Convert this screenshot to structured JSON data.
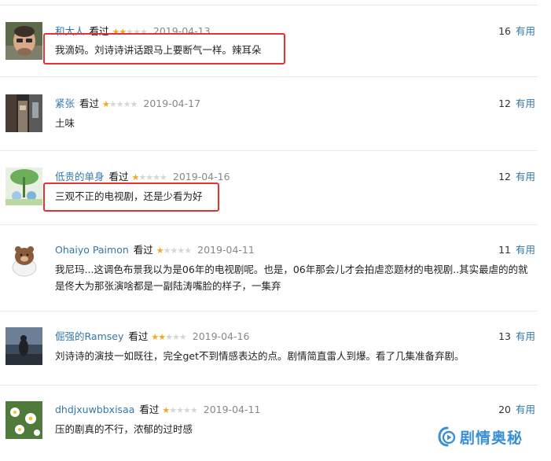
{
  "comments": [
    {
      "user": "和大人",
      "action": "看过",
      "rating": 2,
      "date": "2019-04-13",
      "votes": "16",
      "useful_label": "有用",
      "text": "我滴妈。刘诗诗讲话跟马上要断气一样。辣耳朵",
      "highlighted": true
    },
    {
      "user": "紧张",
      "action": "看过",
      "rating": 1,
      "date": "2019-04-17",
      "votes": "12",
      "useful_label": "有用",
      "text": "土味",
      "highlighted": false
    },
    {
      "user": "低贵的单身",
      "action": "看过",
      "rating": 1,
      "date": "2019-04-16",
      "votes": "12",
      "useful_label": "有用",
      "text": "三观不正的电视剧，还是少看为好",
      "highlighted": true
    },
    {
      "user": "Ohaiyo Paimon",
      "action": "看过",
      "rating": 1,
      "date": "2019-04-11",
      "votes": "11",
      "useful_label": "有用",
      "text": "我尼玛...这调色布景我以为是06年的电视剧呢。也是，06年那会儿才会拍虐恋题材的电视剧..其实最虐的的就是佟大为那张演啥都是一副陆涛嘴脸的样子，一集弃",
      "highlighted": false
    },
    {
      "user": "倔强的Ramsey",
      "action": "看过",
      "rating": 2,
      "date": "2019-04-16",
      "votes": "13",
      "useful_label": "有用",
      "text": "刘诗诗的演技一如既往，完全get不到情感表达的点。剧情简直雷人到爆。看了几集准备弃剧。",
      "highlighted": false
    },
    {
      "user": "dhdjxuwbbxisaa",
      "action": "看过",
      "rating": 1,
      "date": "2019-04-11",
      "votes": "20",
      "useful_label": "有用",
      "text": "压的剧真的不行，浓郁的过时感",
      "highlighted": false
    }
  ],
  "watermark": {
    "text": "剧情奥秘",
    "logo": "play-logo-icon",
    "color": "#3a8fd6"
  },
  "colors": {
    "username": "#3377aa",
    "star_on": "#f5a623",
    "star_off": "#d6d6d6",
    "highlight": "#e53232"
  }
}
